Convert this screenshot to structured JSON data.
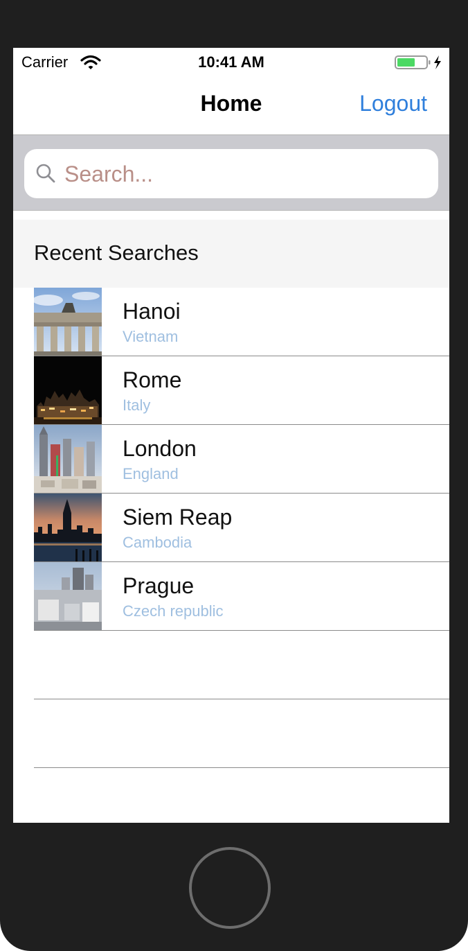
{
  "status_bar": {
    "carrier": "Carrier",
    "time": "10:41 AM",
    "battery_color": "#4cd964"
  },
  "nav": {
    "title": "Home",
    "logout_label": "Logout",
    "accent_color": "#2f7fdc"
  },
  "search": {
    "placeholder": "Search...",
    "value": ""
  },
  "recent": {
    "header": "Recent Searches",
    "items": [
      {
        "city": "Hanoi",
        "country": "Vietnam",
        "thumbnail": "gate-monument-photo"
      },
      {
        "city": "Rome",
        "country": "Italy",
        "thumbnail": "night-skyline-photo"
      },
      {
        "city": "London",
        "country": "England",
        "thumbnail": "casino-towers-photo"
      },
      {
        "city": "Siem Reap",
        "country": "Cambodia",
        "thumbnail": "sunset-skyline-photo"
      },
      {
        "city": "Prague",
        "country": "Czech republic",
        "thumbnail": "city-aerial-photo"
      }
    ]
  }
}
